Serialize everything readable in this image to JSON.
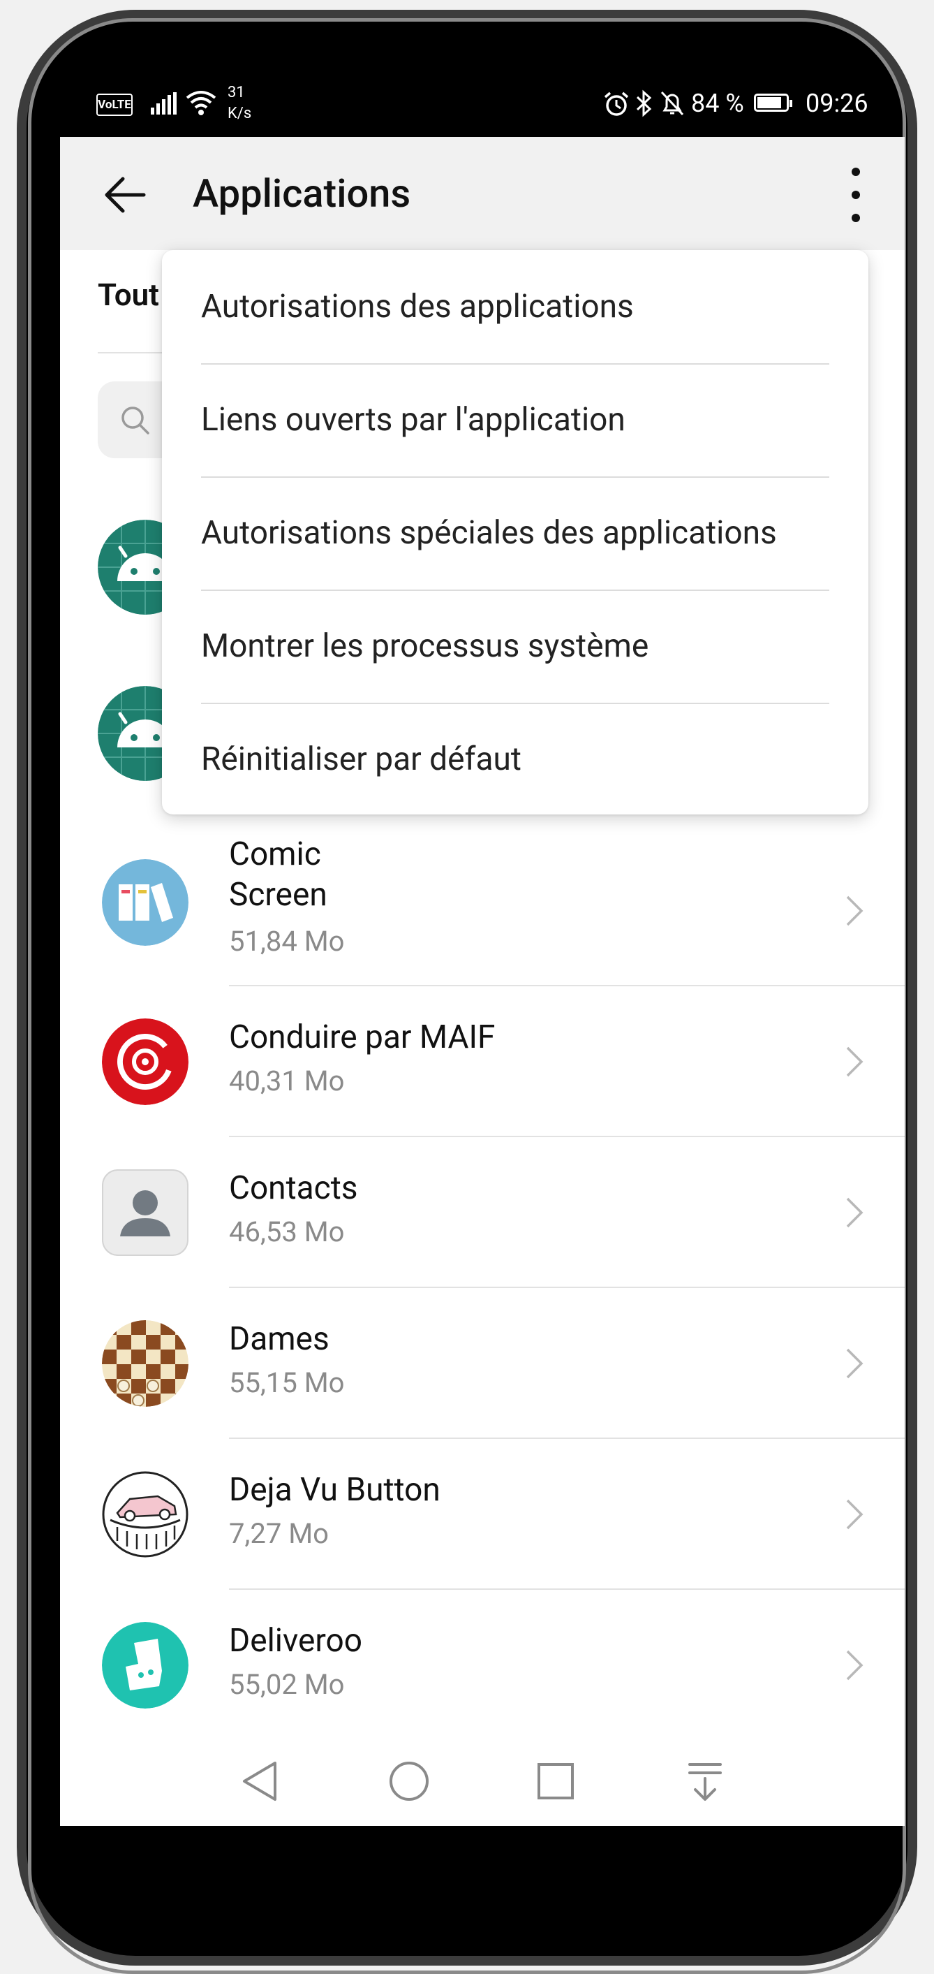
{
  "status_bar": {
    "volte": "VoLTE",
    "speed_value": "31",
    "speed_unit": "K/s",
    "battery": "84 %",
    "battery_level": 0.84,
    "time": "09:26"
  },
  "header": {
    "title": "Applications"
  },
  "tab": {
    "label": "Tout"
  },
  "menu": {
    "items": [
      "Autorisations des applications",
      "Liens ouverts par l'application",
      "Autorisations spéciales des applications",
      "Montrer les processus système",
      "Réinitialiser par défaut"
    ]
  },
  "apps": [
    {
      "name_line1": "Comic",
      "name_line2": "Screen",
      "size": "51,84  Mo",
      "icon": "comic-screen-icon"
    },
    {
      "name_line1": "Conduire par MAIF",
      "size": "40,31  Mo",
      "icon": "maif-icon"
    },
    {
      "name_line1": "Contacts",
      "size": "46,53  Mo",
      "icon": "contacts-icon"
    },
    {
      "name_line1": "Dames",
      "size": "55,15  Mo",
      "icon": "checkers-icon"
    },
    {
      "name_line1": "Deja Vu Button",
      "size": "7,27  Mo",
      "icon": "deja-vu-icon"
    },
    {
      "name_line1": "Deliveroo",
      "size": "55,02  Mo",
      "icon": "deliveroo-icon"
    }
  ],
  "colors": {
    "android_icon": "#1e7f6e",
    "maif_red": "#d8131c",
    "deliveroo_teal": "#1fc2b0",
    "comic_blue": "#74b7db"
  }
}
